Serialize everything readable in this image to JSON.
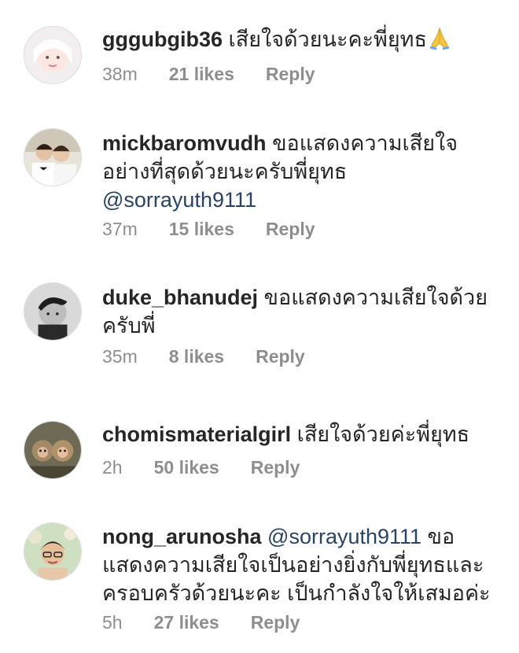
{
  "comments": [
    {
      "username": "gggubgib36",
      "text_before": "",
      "mention": "",
      "text": " เสียใจด้วยนะคะพี่ยุทธ",
      "emoji": "folded-hands",
      "time": "38m",
      "likes": "21 likes",
      "reply": "Reply"
    },
    {
      "username": "mickbaromvudh",
      "text_before": " ขอแสดงความเสียใจอย่างที่สุดด้วยนะครับพี่ยุทธ ",
      "mention": "@sorrayuth9111",
      "text": "",
      "time": "37m",
      "likes": "15 likes",
      "reply": "Reply"
    },
    {
      "username": "duke_bhanudej",
      "text_before": "",
      "mention": "",
      "text": " ขอแสดงความเสียใจด้วยครับพี่",
      "time": "35m",
      "likes": "8 likes",
      "reply": "Reply"
    },
    {
      "username": "chomismaterialgirl",
      "text_before": "",
      "mention": "",
      "text": " เสียใจด้วยค่ะพี่ยุทธ",
      "time": "2h",
      "likes": "50 likes",
      "reply": "Reply"
    },
    {
      "username": "nong_arunosha",
      "text_before": " ",
      "mention": "@sorrayuth9111",
      "text": " ขอแสดงความเสียใจเป็นอย่างยิ่งกับพี่ยุทธและครอบครัวด้วยนะคะ เป็นกำลังใจให้เสมอค่ะ",
      "time": "5h",
      "likes": "27 likes",
      "reply": "Reply"
    }
  ]
}
